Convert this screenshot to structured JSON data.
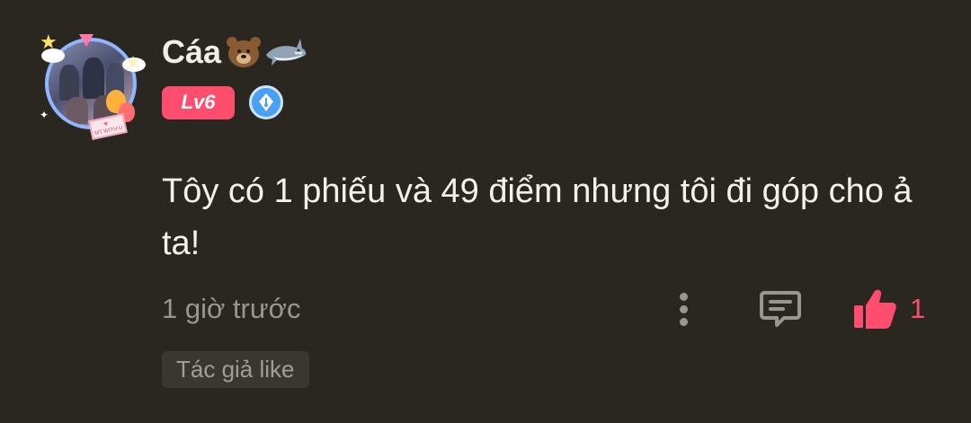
{
  "comment": {
    "username": "Cáa",
    "username_emojis": [
      "bear-face",
      "shark"
    ],
    "level_badge": "Lv6",
    "text": "Tôy có 1 phiếu và 49 điểm nhưng tôi đi góp cho ả ta!",
    "timestamp": "1 giờ trước",
    "like_count": "1",
    "author_liked_tag": "Tác giả like",
    "avatar_letter_text": "MT WITH U"
  },
  "icons": {
    "more": "more-vertical-icon",
    "reply": "comment-reply-icon",
    "like": "thumbs-up-icon",
    "writer_badge": "pen-nib-badge-icon"
  },
  "colors": {
    "background": "#2a2620",
    "accent": "#ff4d6d",
    "muted_text": "#9a958e",
    "badge_blue": "#4aa0f5",
    "tag_background": "#3a3730"
  }
}
